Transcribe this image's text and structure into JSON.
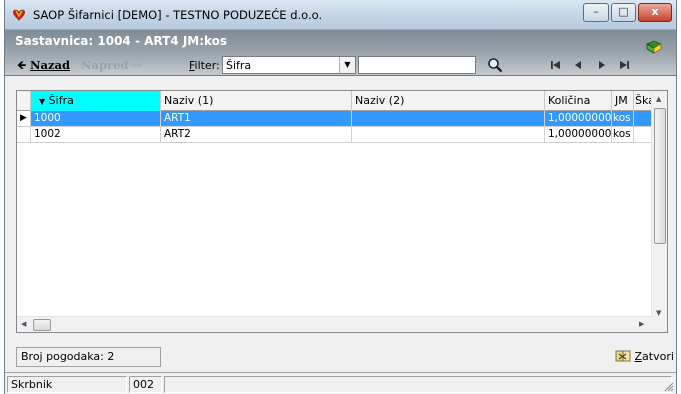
{
  "window": {
    "title": "SAOP Šifarnici [DEMO] - TESTNO PODUZEĆE d.o.o.",
    "controls": {
      "minimize": "–",
      "maximize": "□",
      "close": "x"
    }
  },
  "header": {
    "title": "Sastavnica: 1004 - ART4  JM:kos"
  },
  "toolbar": {
    "back_label": "Nazad",
    "forward_label": "Napred",
    "filter_label_prefix": "F",
    "filter_label_rest": "ilter:",
    "filter_value": "Šifra",
    "search_value": ""
  },
  "grid": {
    "columns": [
      "Šifra",
      "Naziv (1)",
      "Naziv (2)",
      "Količina",
      "JM",
      "Škart"
    ],
    "rows": [
      {
        "sifra": "1000",
        "naziv1": "ART1",
        "naziv2": "",
        "kolicina": "1,000000000",
        "jm": "kos",
        "skart": ""
      },
      {
        "sifra": "1002",
        "naziv1": "ART2",
        "naziv2": "",
        "kolicina": "1,000000000",
        "jm": "kos",
        "skart": ""
      }
    ],
    "selected_row": 0
  },
  "status": {
    "count_label": "Broj pogodaka: 2",
    "close_label_prefix": "Z",
    "close_label_rest": "atvori"
  },
  "footer": {
    "user_label": "Skrbnik",
    "user_code": "002"
  },
  "colors": {
    "header_bg": "#8c969f",
    "selection": "#3399ff",
    "active_column": "#00ffff"
  }
}
